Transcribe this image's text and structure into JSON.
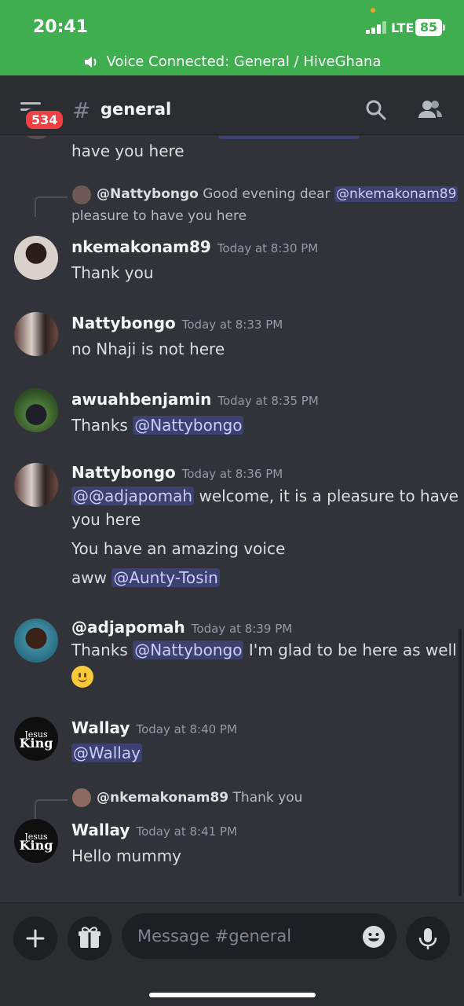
{
  "status": {
    "time": "20:41",
    "network": "LTE",
    "battery": "85"
  },
  "voice_bar": {
    "text": "Voice Connected: General / HiveGhana"
  },
  "header": {
    "badge": "534",
    "hash": "#",
    "channel": "general"
  },
  "messages": {
    "top_partial": "have you here",
    "reply1": {
      "name": "@Nattybongo",
      "text_a": "Good evening dear ",
      "mention": "@nkemakonam89",
      "text_b": "pleasure to have you here"
    },
    "m1": {
      "author": "nkemakonam89",
      "time": "Today at 8:30 PM",
      "text": "Thank you"
    },
    "m2": {
      "author": "Nattybongo",
      "time": "Today at 8:33 PM",
      "text": "no Nhaji is not here"
    },
    "m3": {
      "author": "awuahbenjamin",
      "time": "Today at 8:35 PM",
      "text": "Thanks ",
      "mention": "@Nattybongo"
    },
    "m4": {
      "author": "Nattybongo",
      "time": "Today at 8:36 PM",
      "mention": "@@adjapomah",
      "text_a": " welcome, it is a pleasure to have",
      "text_b": "you here",
      "line2": "You have an amazing voice",
      "line3_text": "aww ",
      "line3_mention": "@Aunty-Tosin"
    },
    "m5": {
      "author": "@adjapomah",
      "time": "Today at 8:39 PM",
      "text_a": "Thanks ",
      "mention": "@Nattybongo",
      "text_b": " I'm glad to be here as well"
    },
    "m6": {
      "author": "Wallay",
      "time": "Today at 8:40 PM",
      "mention": "@Wallay"
    },
    "reply2": {
      "name": "@nkemakonam89",
      "text": "Thank you"
    },
    "m7": {
      "author": "Wallay",
      "time": "Today at 8:41 PM",
      "text": "Hello mummy"
    },
    "jk_avatar": {
      "small": "Jesus",
      "big": "King",
      "tiny": "is"
    }
  },
  "composer": {
    "placeholder": "Message #general"
  },
  "colors": {
    "voice_green": "#3fae4f",
    "mention_bg": "#5865f2",
    "badge_red": "#f23f43",
    "background": "#313338"
  }
}
